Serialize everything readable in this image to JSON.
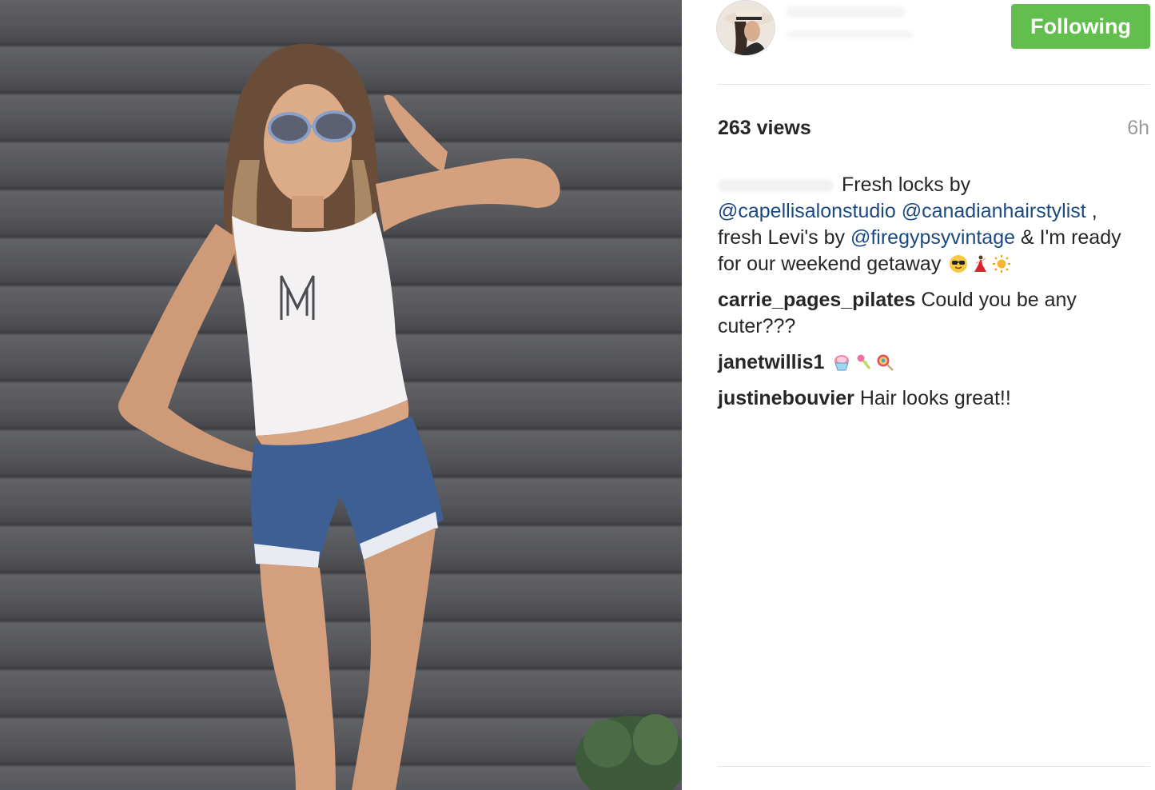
{
  "post": {
    "views": "263 views",
    "time_ago": "6h"
  },
  "header": {
    "follow_label": "Following"
  },
  "caption": {
    "text_1": "Fresh locks by",
    "mention_1": "@capellisalonstudio",
    "mention_2": "@canadianhairstylist",
    "text_2": ",",
    "text_3": "fresh Levi's by",
    "mention_3": "@firegypsyvintage",
    "text_4": "& I'm ready for our weekend getaway",
    "emojis": [
      "sunglasses-face-emoji",
      "dancer-emoji",
      "sun-emoji"
    ]
  },
  "comments": [
    {
      "user": "carrie_pages_pilates",
      "text": "Could you be any cuter???"
    },
    {
      "user": "janetwillis1",
      "text": "",
      "emojis": [
        "shaved-ice-emoji",
        "candy-emoji",
        "lollipop-emoji"
      ]
    },
    {
      "user": "justinebouvier",
      "text": "Hair looks great!!"
    }
  ],
  "colors": {
    "follow_button": "#62bf4e",
    "mention": "#1b4a82",
    "text": "#262626",
    "muted": "#9a9a9a"
  }
}
